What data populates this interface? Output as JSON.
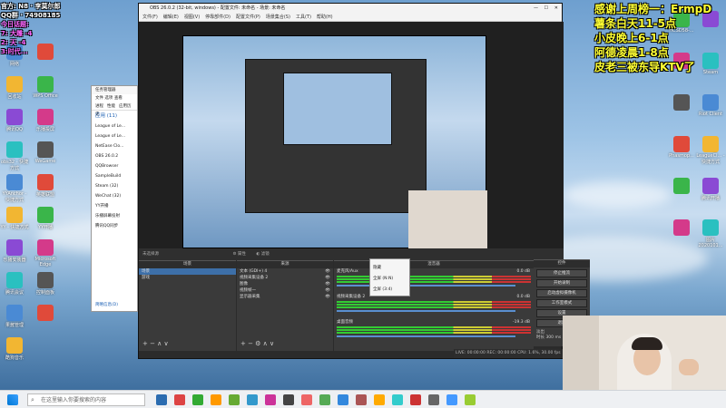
{
  "overlay": {
    "top_left_lines": [
      "官方: N8 · 李莫尔郎",
      "QQ群 · 74908185",
      "今日话题:",
      "7: 大雕 -4",
      "2: 天 -4",
      "3:时代..."
    ],
    "top_right_lines": [
      "感谢上周榜一：ErmpD",
      "薯条白天11-5点",
      "小皮晚上6-1点",
      "阿德凌晨1-8点",
      "皮老三被东导KTV了"
    ]
  },
  "desktop": {
    "left_icons": [
      "网络",
      "",
      "回收站",
      "WPS Office",
      "腾讯QQ",
      "乐播投屏",
      "obs32 - 快捷方式",
      "WeGame",
      "YYAnchor - 快捷方式",
      "英雄联盟",
      "YY - 快捷方式",
      "YY开播",
      "乐播安装器",
      "Microsoft Edge",
      "腾讯会议",
      "控制面板",
      "果酱管理",
      "",
      "酷狗音乐"
    ],
    "right_icons": [
      "HCSD58-...",
      "",
      "",
      "Steam",
      "",
      "Riot Client",
      "Phasmop...",
      "LeagueCl... - 快捷方式",
      "",
      "腾讯开播",
      "",
      "图片 2020101..."
    ]
  },
  "obs": {
    "title": "OBS 26.0.2 (32-bit, windows) - 配置文件: 未命名 - 场景: 未命名",
    "menu": [
      "文件(F)",
      "编辑(E)",
      "视图(V)",
      "停靠部件(D)",
      "配置文件(P)",
      "场景集合(S)",
      "工具(T)",
      "帮助(H)"
    ],
    "no_source_selected": "未选择源",
    "properties_btn": "属性",
    "filters_btn": "滤镜",
    "scenes": {
      "header": "场景",
      "items": [
        "场景",
        "游戏"
      ]
    },
    "sources": {
      "header": "来源",
      "items": [
        "文本 (GDI+) 4",
        "视频采集设备 2",
        "图像",
        "视频帧一",
        "显示器采集"
      ]
    },
    "mixer": {
      "header": "混音器",
      "tracks": [
        {
          "name": "麦克风/Aux",
          "db": "0.0 dB"
        },
        {
          "name": "视频采集设备 2",
          "db": "0.0 dB"
        },
        {
          "name": "桌面音频",
          "db": "-19.3 dB"
        }
      ]
    },
    "transitions": {
      "header": "转场特效",
      "fade": "淡出",
      "duration_label": "时长",
      "duration": "300 ms"
    },
    "controls": {
      "header": "控件",
      "buttons": [
        "停止推流",
        "开始录制",
        "启动虚拟摄像机",
        "工作室模式",
        "设置",
        "退出"
      ]
    },
    "status": {
      "live": "LIVE: 00:00:00",
      "rec": "REC: 00:00:00",
      "cpu": "CPU: 1.6%, 30.00 fps"
    }
  },
  "context_menu": {
    "items": [
      "隐藏",
      "全屏 (N:N)",
      "全屏 (3:4)"
    ]
  },
  "task_manager": {
    "title": "任务管理器",
    "menu": "文件 选项 查看",
    "tabs": [
      "进程",
      "性能",
      "应用历史"
    ],
    "section": "应用 (11)",
    "apps": [
      "League of Le...",
      "League of Le...",
      "NetEase Clo...",
      "OBS 26.0.2",
      "QQBrowser",
      "SampleBuild",
      "Steam (32)",
      "WeChat (32)",
      "YY开播",
      "乐播屏幕投射",
      "腾讯QQ同步"
    ],
    "less_details": "简略信息(D)"
  },
  "taskbar": {
    "search_placeholder": "在这里输入你要搜索的内容"
  }
}
